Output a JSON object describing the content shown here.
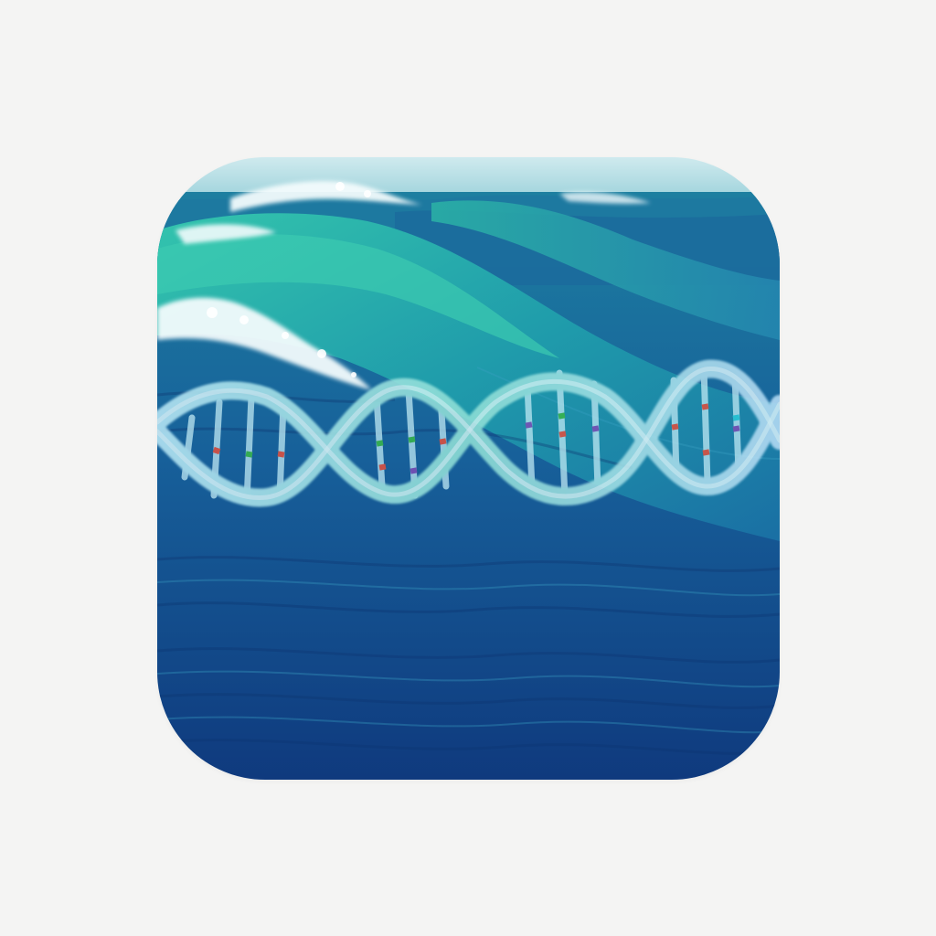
{
  "icon": {
    "subject": "ocean-wave-dna-helix",
    "colors": {
      "background": "#f4f4f3",
      "sky": "#bfe4ea",
      "wave_light": "#2fb9a8",
      "wave_mid": "#1f8fa6",
      "ocean_deep": "#123f85",
      "foam": "#f4fbfc",
      "helix": "#a9e3f0",
      "base_pair_green": "#39b54a",
      "base_pair_red": "#e0503f",
      "base_pair_purple": "#7b4fb6",
      "base_pair_cyan": "#29c7d8"
    }
  }
}
